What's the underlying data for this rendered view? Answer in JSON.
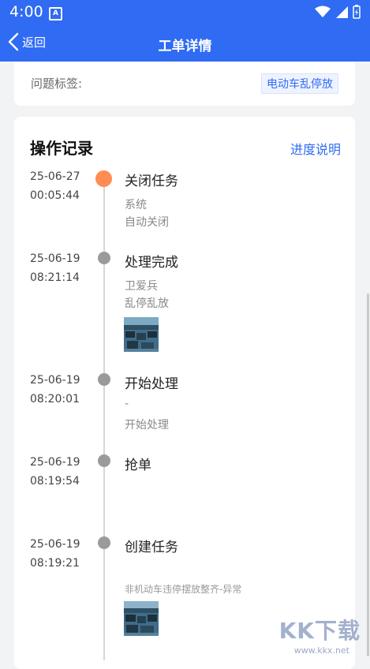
{
  "status_bar": {
    "time": "4:00",
    "notification_badge": "A"
  },
  "header": {
    "back_label": "返回",
    "title": "工单详情"
  },
  "issue": {
    "tag_label": "问题标签:",
    "tag_value": "电动车乱停放"
  },
  "records": {
    "title": "操作记录",
    "progress_link": "进度说明",
    "items": [
      {
        "date": "25-06-27",
        "time": "00:05:44",
        "action": "关闭任务",
        "actor": "系统",
        "note": "自动关闭",
        "active": true
      },
      {
        "date": "25-06-19",
        "time": "08:21:14",
        "action": "处理完成",
        "actor": "卫爱兵",
        "note": "乱停乱放",
        "photo": "parking-photo"
      },
      {
        "date": "25-06-19",
        "time": "08:20:01",
        "action": "开始处理",
        "actor": "-",
        "note": "开始处理"
      },
      {
        "date": "25-06-19",
        "time": "08:19:54",
        "action": "抢单"
      },
      {
        "date": "25-06-19",
        "time": "08:19:21",
        "action": "创建任务",
        "note": "非机动车违停摆放整齐-异常",
        "photo": "parking-photo"
      }
    ]
  },
  "watermark": {
    "text": "KK下载",
    "url": "www.kkx.net"
  },
  "colors": {
    "primary": "#2f6bf3",
    "active_dot": "#ff8c52",
    "inactive_dot": "#9a9a9a"
  }
}
